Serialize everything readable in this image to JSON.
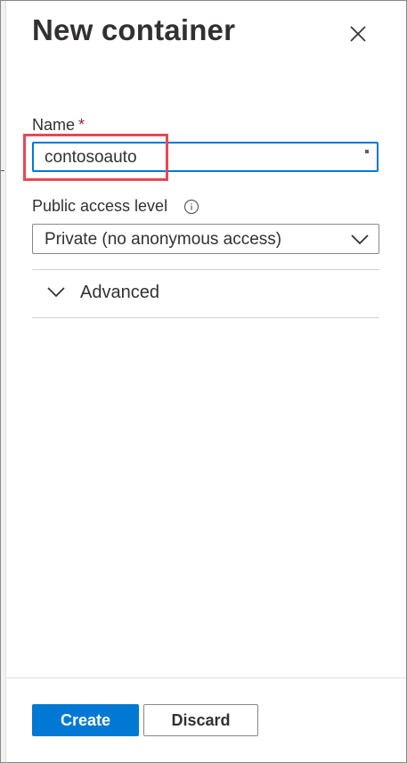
{
  "panel": {
    "title": "New container",
    "close_icon": "close-icon"
  },
  "form": {
    "name": {
      "label": "Name",
      "required_marker": "*",
      "value": "contosoauto"
    },
    "access_level": {
      "label": "Public access level",
      "info_icon": "info-icon",
      "selected": "Private (no anonymous access)"
    },
    "advanced": {
      "label": "Advanced",
      "icon": "chevron-down-icon"
    }
  },
  "footer": {
    "create_label": "Create",
    "discard_label": "Discard"
  },
  "colors": {
    "primary": "#0078d4",
    "required": "#a4262c",
    "highlight": "#e74856",
    "text": "#323130"
  }
}
